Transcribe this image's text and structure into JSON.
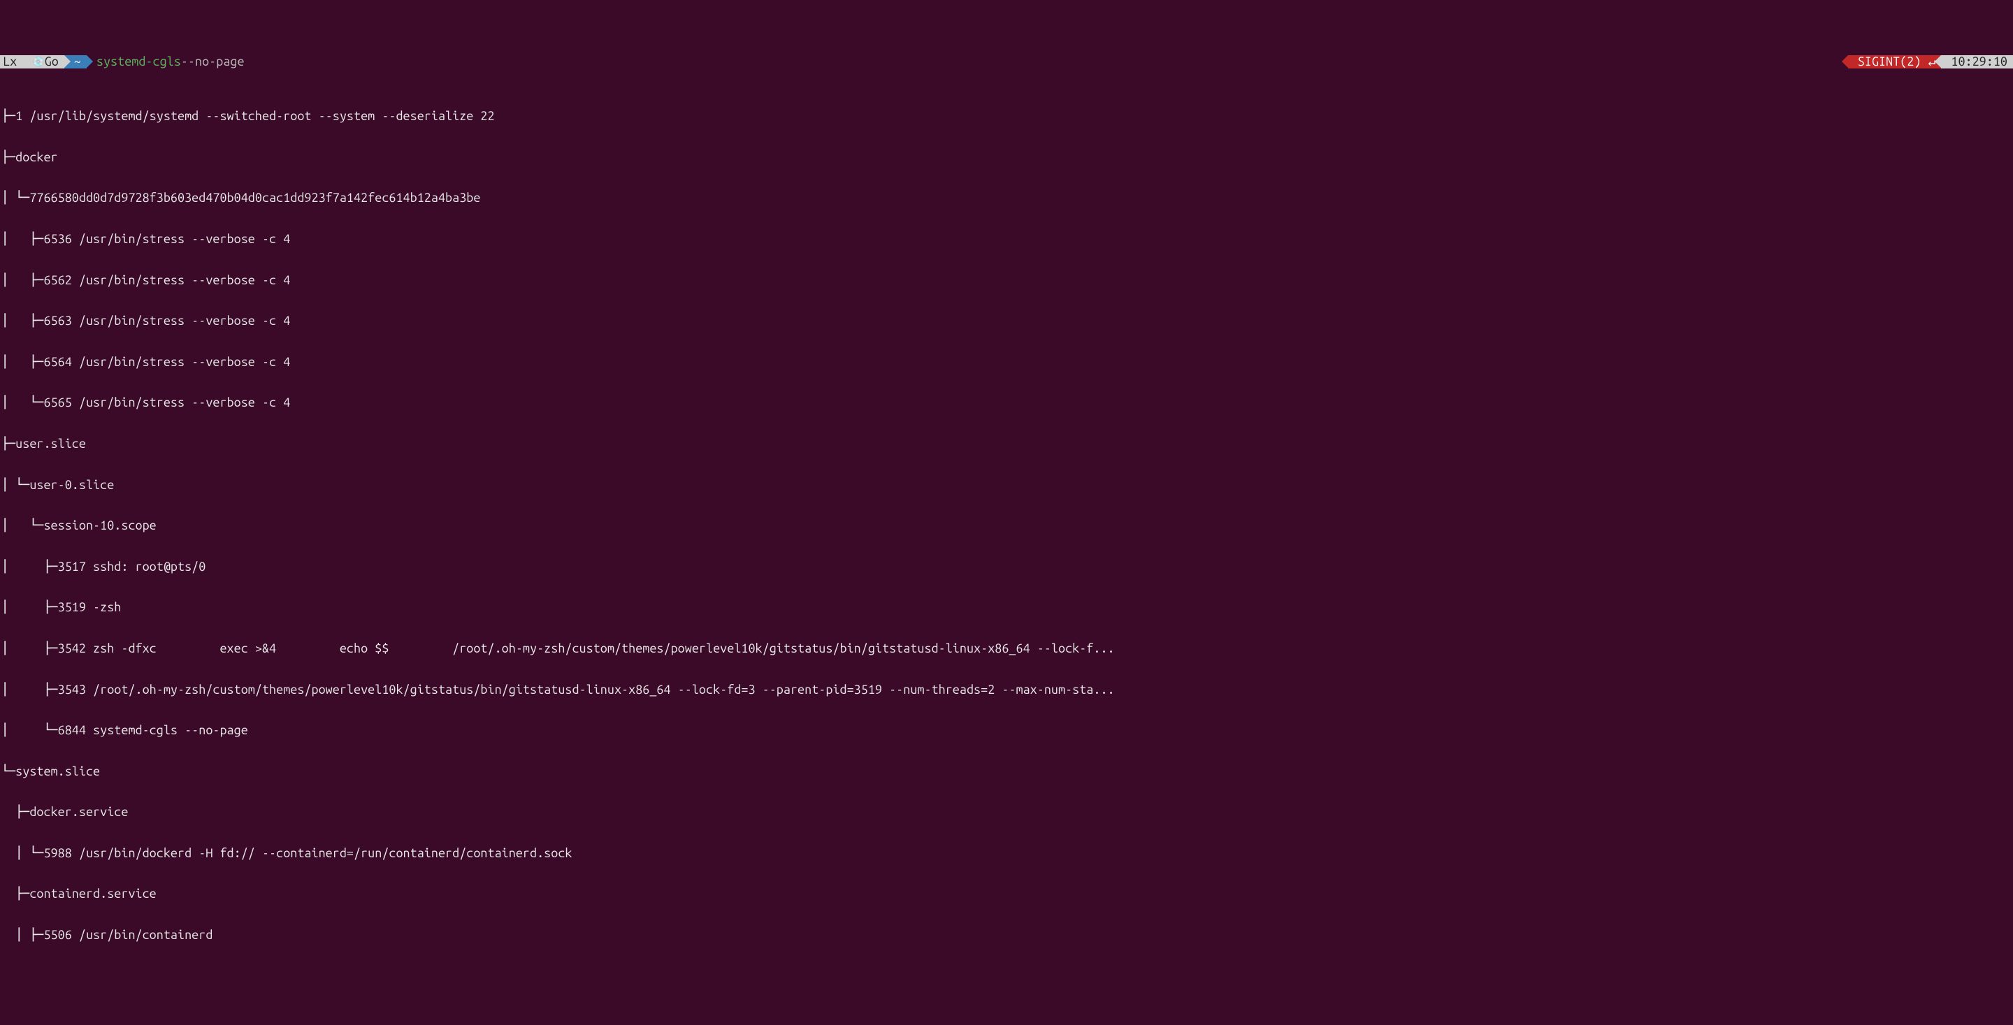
{
  "prompt": {
    "lx": "Lx",
    "go": "Go",
    "tilde": "~",
    "cmd": "systemd-cgls",
    "arg": "--no-page",
    "sigint": "SIGINT(2) ↵",
    "time": "10:29:10"
  },
  "lines": [
    "├─1 /usr/lib/systemd/systemd --switched-root --system --deserialize 22",
    "├─docker",
    "│ └─7766580dd0d7d9728f3b603ed470b04d0cac1dd923f7a142fec614b12a4ba3be",
    "│   ├─6536 /usr/bin/stress --verbose -c 4",
    "│   ├─6562 /usr/bin/stress --verbose -c 4",
    "│   ├─6563 /usr/bin/stress --verbose -c 4",
    "│   ├─6564 /usr/bin/stress --verbose -c 4",
    "│   └─6565 /usr/bin/stress --verbose -c 4",
    "├─user.slice",
    "│ └─user-0.slice",
    "│   └─session-10.scope",
    "│     ├─3517 sshd: root@pts/0",
    "│     ├─3519 -zsh",
    "│     ├─3542 zsh -dfxc         exec >&4         echo $$         /root/.oh-my-zsh/custom/themes/powerlevel10k/gitstatus/bin/gitstatusd-linux-x86_64 --lock-f...",
    "│     ├─3543 /root/.oh-my-zsh/custom/themes/powerlevel10k/gitstatus/bin/gitstatusd-linux-x86_64 --lock-fd=3 --parent-pid=3519 --num-threads=2 --max-num-sta...",
    "│     └─6844 systemd-cgls --no-page",
    "└─system.slice",
    "  ├─docker.service",
    "  │ └─5988 /usr/bin/dockerd -H fd:// --containerd=/run/containerd/containerd.sock",
    "  ├─containerd.service",
    "  │ ├─5506 /usr/bin/containerd"
  ]
}
